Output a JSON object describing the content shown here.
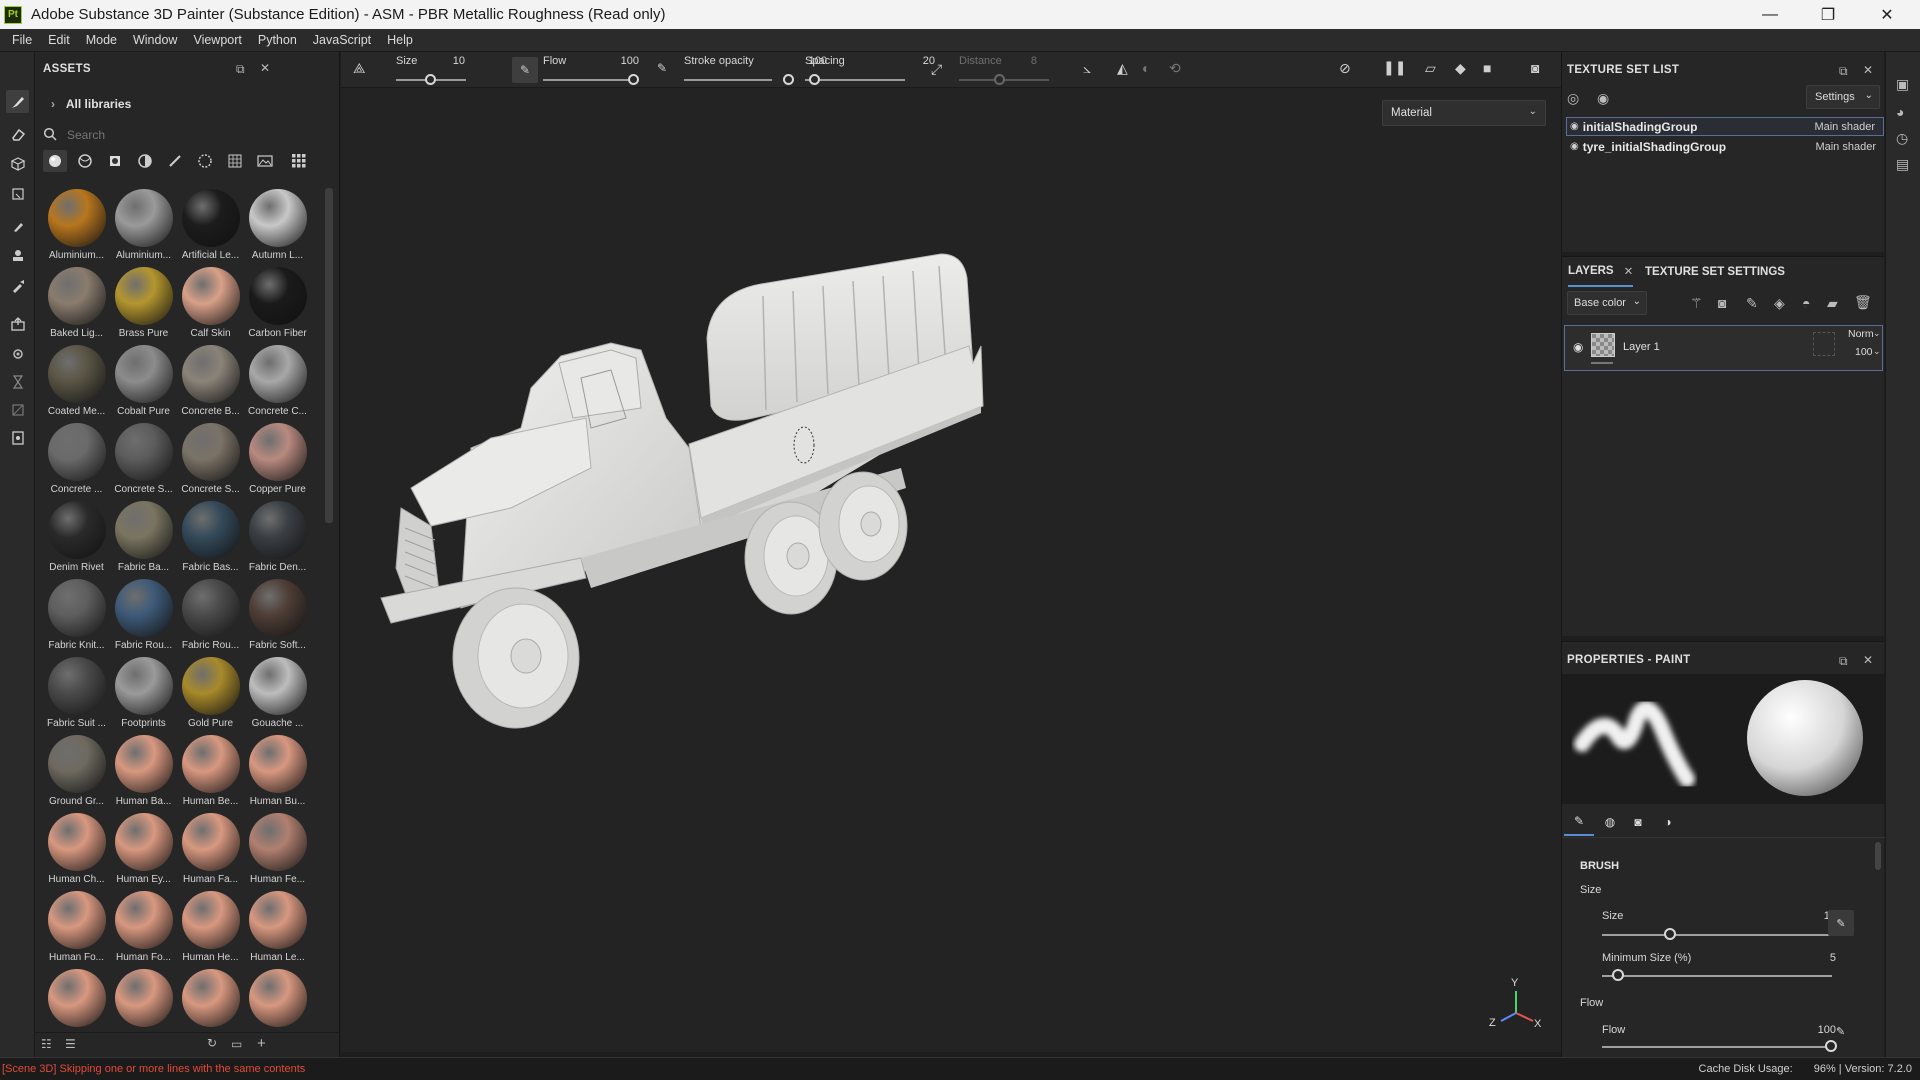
{
  "window": {
    "title": "Adobe Substance 3D Painter (Substance Edition) - ASM - PBR Metallic Roughness (Read only)",
    "app_icon_text": "Pt",
    "minimize": "—",
    "restore": "❐",
    "close": "✕"
  },
  "menu": [
    "File",
    "Edit",
    "Mode",
    "Window",
    "Viewport",
    "Python",
    "JavaScript",
    "Help"
  ],
  "assets": {
    "title": "ASSETS",
    "libraries": "All libraries",
    "search_placeholder": "Search",
    "items": [
      {
        "label": "Aluminium...",
        "color": "#b8761e"
      },
      {
        "label": "Aluminium...",
        "color": "#9a9a9a"
      },
      {
        "label": "Artificial Le...",
        "color": "#1c1c1c"
      },
      {
        "label": "Autumn L...",
        "color": "#c8c8c8"
      },
      {
        "label": "Baked Lig...",
        "color": "#8a7c6e"
      },
      {
        "label": "Brass Pure",
        "color": "#b4962e"
      },
      {
        "label": "Calf Skin",
        "color": "#d8a088"
      },
      {
        "label": "Carbon Fiber",
        "color": "#1a1a1a"
      },
      {
        "label": "Coated Me...",
        "color": "#5a5545"
      },
      {
        "label": "Cobalt Pure",
        "color": "#8c8c8c"
      },
      {
        "label": "Concrete B...",
        "color": "#8a8378"
      },
      {
        "label": "Concrete C...",
        "color": "#a8a8a8"
      },
      {
        "label": "Concrete ...",
        "color": "#6a6a6a"
      },
      {
        "label": "Concrete S...",
        "color": "#5c5c5c"
      },
      {
        "label": "Concrete S...",
        "color": "#7a7266"
      },
      {
        "label": "Copper Pure",
        "color": "#b88a80"
      },
      {
        "label": "Denim Rivet",
        "color": "#2a2a2a"
      },
      {
        "label": "Fabric Ba...",
        "color": "#7a7560"
      },
      {
        "label": "Fabric Bas...",
        "color": "#344a5a"
      },
      {
        "label": "Fabric Den...",
        "color": "#3a3f44"
      },
      {
        "label": "Fabric Knit...",
        "color": "#5e5e5e"
      },
      {
        "label": "Fabric Rou...",
        "color": "#3e5a78"
      },
      {
        "label": "Fabric Rou...",
        "color": "#4a4a4a"
      },
      {
        "label": "Fabric Soft...",
        "color": "#4e3e36"
      },
      {
        "label": "Fabric Suit ...",
        "color": "#4a4a4a"
      },
      {
        "label": "Footprints",
        "color": "#9a9a9a"
      },
      {
        "label": "Gold Pure",
        "color": "#a88a2a"
      },
      {
        "label": "Gouache ...",
        "color": "#bdbdbd"
      },
      {
        "label": "Ground Gr...",
        "color": "#6e6a60"
      },
      {
        "label": "Human Ba...",
        "color": "#d89880"
      },
      {
        "label": "Human Be...",
        "color": "#d89880"
      },
      {
        "label": "Human Bu...",
        "color": "#d89880"
      },
      {
        "label": "Human Ch...",
        "color": "#d89880"
      },
      {
        "label": "Human Ey...",
        "color": "#d89880"
      },
      {
        "label": "Human Fa...",
        "color": "#d89880"
      },
      {
        "label": "Human Fe...",
        "color": "#b08070"
      },
      {
        "label": "Human Fo...",
        "color": "#d89880"
      },
      {
        "label": "Human Fo...",
        "color": "#d89880"
      },
      {
        "label": "Human He...",
        "color": "#d89880"
      },
      {
        "label": "Human Le...",
        "color": "#d89880"
      },
      {
        "label": "",
        "color": "#d89880"
      },
      {
        "label": "",
        "color": "#d89880"
      },
      {
        "label": "",
        "color": "#d89880"
      },
      {
        "label": "",
        "color": "#d89880"
      }
    ]
  },
  "brushbar": {
    "size_label": "Size",
    "size_value": "10",
    "flow_label": "Flow",
    "flow_value": "100",
    "opacity_label": "Stroke opacity",
    "opacity_value": "100",
    "spacing_label": "Spacing",
    "spacing_value": "20",
    "distance_label": "Distance",
    "distance_value": "8"
  },
  "viewport": {
    "material_mode": "Material",
    "axis_y": "Y",
    "axis_z": "Z",
    "axis_x": "X"
  },
  "texture_set_list": {
    "title": "TEXTURE SET LIST",
    "settings_label": "Settings",
    "sets": [
      {
        "name": "initialShadingGroup",
        "shader": "Main shader"
      },
      {
        "name": "tyre_initialShadingGroup",
        "shader": "Main shader"
      }
    ]
  },
  "layers": {
    "tab_layers": "LAYERS",
    "tab_settings": "TEXTURE SET SETTINGS",
    "channel": "Base color",
    "layer_name": "Layer 1",
    "blend_mode": "Norm",
    "opacity": "100"
  },
  "properties": {
    "title": "PROPERTIES - PAINT",
    "section": "BRUSH",
    "size_group": "Size",
    "size_label": "Size",
    "size_value": "10",
    "min_size_label": "Minimum Size (%)",
    "min_size_value": "5",
    "flow_group": "Flow",
    "flow_label": "Flow",
    "flow_value": "100"
  },
  "status": {
    "message": "[Scene 3D] Skipping one or more lines with the same contents",
    "cache": "Cache Disk Usage:",
    "cache_value": "96% | Version: 7.2.0"
  },
  "colors": {
    "accent_border": "#5a6e96",
    "error_text": "#e14a3a",
    "logo_green": "#a3d21e"
  }
}
